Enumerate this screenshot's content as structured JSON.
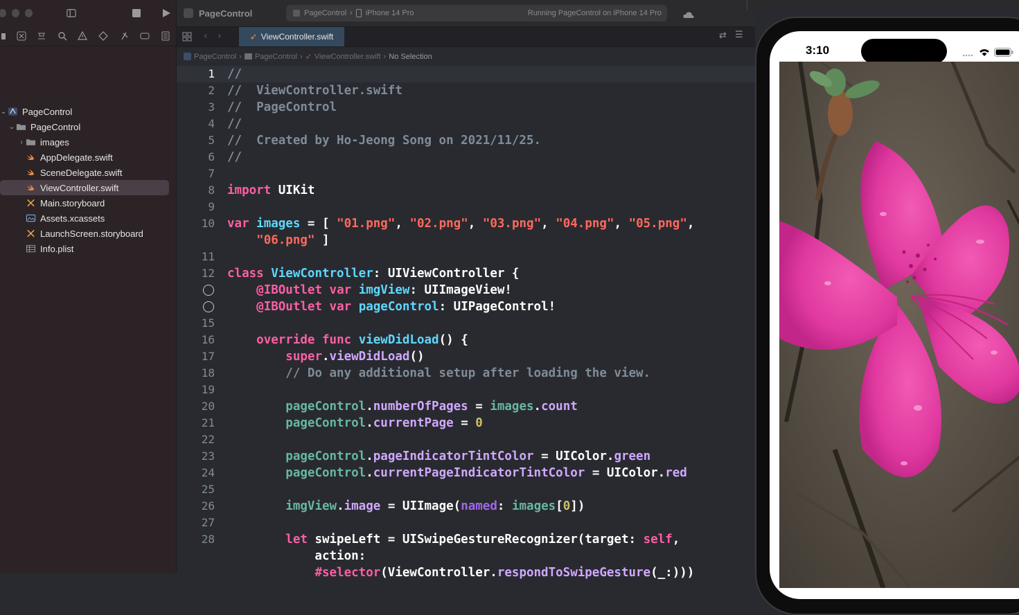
{
  "app": {
    "project": "PageControl",
    "scheme": "PageControl",
    "destination": "iPhone 14 Pro",
    "run_status": "Running PageControl on iPhone 14 Pro"
  },
  "navigator": {
    "items": [
      {
        "label": "PageControl",
        "icon": "project-icon",
        "disc": "⌄"
      },
      {
        "label": "PageControl",
        "icon": "folder-icon",
        "disc": "⌄"
      },
      {
        "label": "images",
        "icon": "folder-icon",
        "disc": "›"
      },
      {
        "label": "AppDelegate.swift",
        "icon": "swift-file-icon",
        "disc": ""
      },
      {
        "label": "SceneDelegate.swift",
        "icon": "swift-file-icon",
        "disc": ""
      },
      {
        "label": "ViewController.swift",
        "icon": "swift-file-icon",
        "disc": ""
      },
      {
        "label": "Main.storyboard",
        "icon": "storyboard-icon",
        "disc": ""
      },
      {
        "label": "Assets.xcassets",
        "icon": "asset-catalog-icon",
        "disc": ""
      },
      {
        "label": "LaunchScreen.storyboard",
        "icon": "storyboard-icon",
        "disc": ""
      },
      {
        "label": "Info.plist",
        "icon": "plist-icon",
        "disc": ""
      }
    ]
  },
  "editor": {
    "tab_label": "ViewController.swift",
    "jump": [
      "PageControl",
      "PageControl",
      "ViewController.swift",
      "No Selection"
    ],
    "line_numbers": [
      "1",
      "2",
      "3",
      "4",
      "5",
      "6",
      "7",
      "8",
      "9",
      "10",
      "",
      "11",
      "12",
      "",
      "",
      "15",
      "16",
      "17",
      "18",
      "19",
      "20",
      "21",
      "22",
      "23",
      "24",
      "25",
      "26",
      "27",
      "28",
      "",
      ""
    ],
    "lines": [
      [
        [
          "cm",
          "//"
        ]
      ],
      [
        [
          "cm",
          "//  ViewController.swift"
        ]
      ],
      [
        [
          "cm",
          "//  PageControl"
        ]
      ],
      [
        [
          "cm",
          "//"
        ]
      ],
      [
        [
          "cm",
          "//  Created by Ho-Jeong Song on 2021/11/25."
        ]
      ],
      [
        [
          "cm",
          "//"
        ]
      ],
      [],
      [
        [
          "kw",
          "import"
        ],
        [
          "pl",
          " UIKit"
        ]
      ],
      [],
      [
        [
          "kw",
          "var"
        ],
        [
          "pl",
          " "
        ],
        [
          "nt",
          "images"
        ],
        [
          "pl",
          " = [ "
        ],
        [
          "st",
          "\"01.png\""
        ],
        [
          "pl",
          ", "
        ],
        [
          "st",
          "\"02.png\""
        ],
        [
          "pl",
          ", "
        ],
        [
          "st",
          "\"03.png\""
        ],
        [
          "pl",
          ", "
        ],
        [
          "st",
          "\"04.png\""
        ],
        [
          "pl",
          ", "
        ],
        [
          "st",
          "\"05.png\""
        ],
        [
          "pl",
          ","
        ]
      ],
      [
        [
          "pl",
          "    "
        ],
        [
          "st",
          "\"06.png\""
        ],
        [
          "pl",
          " ]"
        ]
      ],
      [],
      [
        [
          "kw",
          "class"
        ],
        [
          "pl",
          " "
        ],
        [
          "nt",
          "ViewController"
        ],
        [
          "pl",
          ": UIViewController {"
        ]
      ],
      [
        [
          "pl",
          "    "
        ],
        [
          "kw",
          "@IBOutlet"
        ],
        [
          "pl",
          " "
        ],
        [
          "kw",
          "var"
        ],
        [
          "pl",
          " "
        ],
        [
          "nt",
          "imgView"
        ],
        [
          "pl",
          ": UIImageView!"
        ]
      ],
      [
        [
          "pl",
          "    "
        ],
        [
          "kw",
          "@IBOutlet"
        ],
        [
          "pl",
          " "
        ],
        [
          "kw",
          "var"
        ],
        [
          "pl",
          " "
        ],
        [
          "nt",
          "pageControl"
        ],
        [
          "pl",
          ": UIPageControl!"
        ]
      ],
      [],
      [
        [
          "pl",
          "    "
        ],
        [
          "kw",
          "override"
        ],
        [
          "pl",
          " "
        ],
        [
          "kw",
          "func"
        ],
        [
          "pl",
          " "
        ],
        [
          "nt",
          "viewDidLoad"
        ],
        [
          "pl",
          "() {"
        ]
      ],
      [
        [
          "pl",
          "        "
        ],
        [
          "kw",
          "super"
        ],
        [
          "pl",
          "."
        ],
        [
          "tp",
          "viewDidLoad"
        ],
        [
          "pl",
          "()"
        ]
      ],
      [
        [
          "pl",
          "        "
        ],
        [
          "cm",
          "// Do any additional setup after loading the view."
        ]
      ],
      [],
      [
        [
          "pl",
          "        "
        ],
        [
          "id",
          "pageControl"
        ],
        [
          "pl",
          "."
        ],
        [
          "tp",
          "numberOfPages"
        ],
        [
          "pl",
          " = "
        ],
        [
          "id",
          "images"
        ],
        [
          "pl",
          "."
        ],
        [
          "tp",
          "count"
        ]
      ],
      [
        [
          "pl",
          "        "
        ],
        [
          "id",
          "pageControl"
        ],
        [
          "pl",
          "."
        ],
        [
          "tp",
          "currentPage"
        ],
        [
          "pl",
          " = "
        ],
        [
          "nu",
          "0"
        ]
      ],
      [],
      [
        [
          "pl",
          "        "
        ],
        [
          "id",
          "pageControl"
        ],
        [
          "pl",
          "."
        ],
        [
          "tp",
          "pageIndicatorTintColor"
        ],
        [
          "pl",
          " = UIColor."
        ],
        [
          "tp",
          "green"
        ]
      ],
      [
        [
          "pl",
          "        "
        ],
        [
          "id",
          "pageControl"
        ],
        [
          "pl",
          "."
        ],
        [
          "tp",
          "currentPageIndicatorTintColor"
        ],
        [
          "pl",
          " = UIColor."
        ],
        [
          "tp",
          "red"
        ]
      ],
      [],
      [
        [
          "pl",
          "        "
        ],
        [
          "id",
          "imgView"
        ],
        [
          "pl",
          "."
        ],
        [
          "tp",
          "image"
        ],
        [
          "pl",
          " = UIImage("
        ],
        [
          "pm",
          "named"
        ],
        [
          "pl",
          ": "
        ],
        [
          "id",
          "images"
        ],
        [
          "pl",
          "["
        ],
        [
          "nu",
          "0"
        ],
        [
          "pl",
          "])"
        ]
      ],
      [],
      [
        [
          "pl",
          "        "
        ],
        [
          "kw",
          "let"
        ],
        [
          "pl",
          " swipeLeft = UISwipeGestureRecognizer(target: "
        ],
        [
          "kw",
          "self"
        ],
        [
          "pl",
          ","
        ]
      ],
      [
        [
          "pl",
          "            action:"
        ]
      ],
      [
        [
          "pl",
          "            "
        ],
        [
          "kw",
          "#selector"
        ],
        [
          "pl",
          "(ViewController."
        ],
        [
          "tp",
          "respondToSwipeGesture"
        ],
        [
          "pl",
          "(_:)))"
        ]
      ]
    ]
  },
  "simulator": {
    "time": "3:10"
  },
  "colors": {
    "keyword": "#fc5fa3",
    "string": "#fc6a5d",
    "comment": "#7f8c98",
    "type_decl": "#5dd8ff",
    "identifier": "#67b7a4",
    "number": "#d0bf69",
    "navigator_bg": "#2b2325",
    "editor_bg": "#292a30",
    "flower": "#e0399f"
  }
}
